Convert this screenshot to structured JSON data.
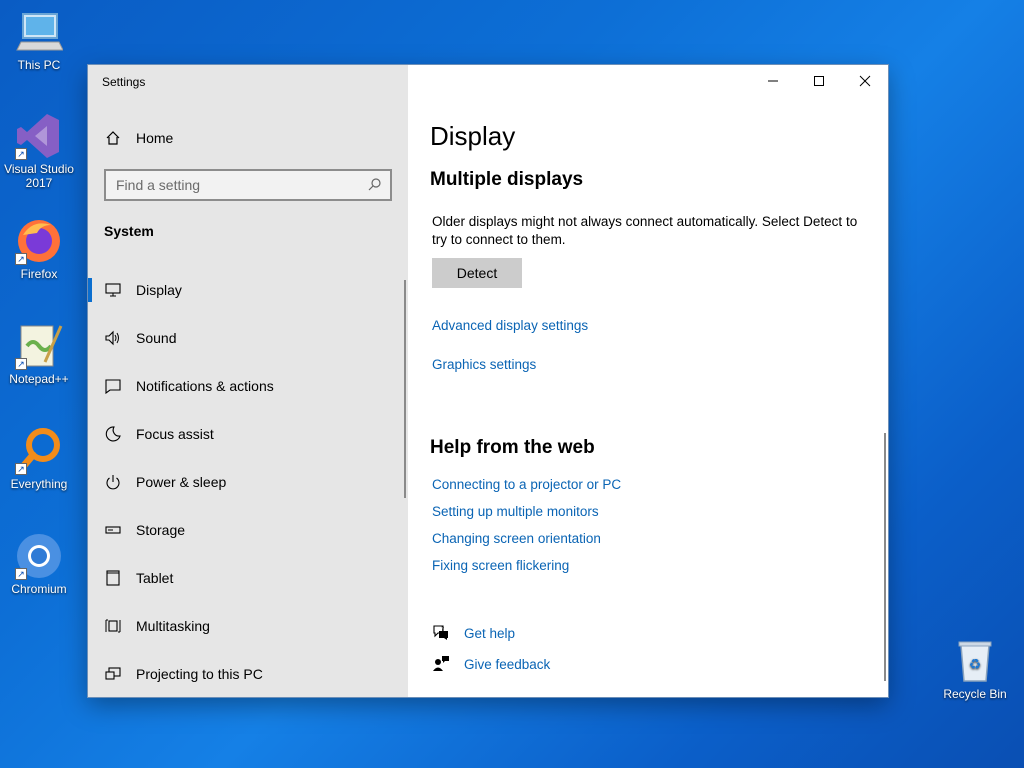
{
  "desktop": {
    "icons": [
      {
        "label": "This PC",
        "icon": "computer-icon"
      },
      {
        "label": "Visual Studio 2017",
        "icon": "visual-studio-icon"
      },
      {
        "label": "Firefox",
        "icon": "firefox-icon"
      },
      {
        "label": "Notepad++",
        "icon": "notepad-plus-plus-icon"
      },
      {
        "label": "Everything",
        "icon": "everything-search-icon"
      },
      {
        "label": "Chromium",
        "icon": "chromium-icon"
      },
      {
        "label": "Recycle Bin",
        "icon": "recycle-bin-icon"
      }
    ]
  },
  "window": {
    "title": "Settings"
  },
  "sidebar": {
    "home_label": "Home",
    "search_placeholder": "Find a setting",
    "section_label": "System",
    "items": [
      {
        "label": "Display",
        "icon": "monitor-icon",
        "active": true
      },
      {
        "label": "Sound",
        "icon": "speaker-icon",
        "active": false
      },
      {
        "label": "Notifications & actions",
        "icon": "notification-icon",
        "active": false
      },
      {
        "label": "Focus assist",
        "icon": "moon-icon",
        "active": false
      },
      {
        "label": "Power & sleep",
        "icon": "power-icon",
        "active": false
      },
      {
        "label": "Storage",
        "icon": "storage-icon",
        "active": false
      },
      {
        "label": "Tablet",
        "icon": "tablet-icon",
        "active": false
      },
      {
        "label": "Multitasking",
        "icon": "multitasking-icon",
        "active": false
      },
      {
        "label": "Projecting to this PC",
        "icon": "projecting-icon",
        "active": false
      }
    ]
  },
  "main": {
    "page_title": "Display",
    "section_title": "Multiple displays",
    "description": "Older displays might not always connect automatically. Select Detect to try to connect to them.",
    "detect_label": "Detect",
    "links": {
      "advanced": "Advanced display settings",
      "graphics": "Graphics settings"
    },
    "help": {
      "title": "Help from the web",
      "links": [
        "Connecting to a projector or PC",
        "Setting up multiple monitors",
        "Changing screen orientation",
        "Fixing screen flickering"
      ],
      "get_help": "Get help",
      "give_feedback": "Give feedback"
    }
  },
  "colors": {
    "accent": "#0a6ecf",
    "link": "#0a64b4",
    "sidebar_bg": "#e6e6e6"
  }
}
